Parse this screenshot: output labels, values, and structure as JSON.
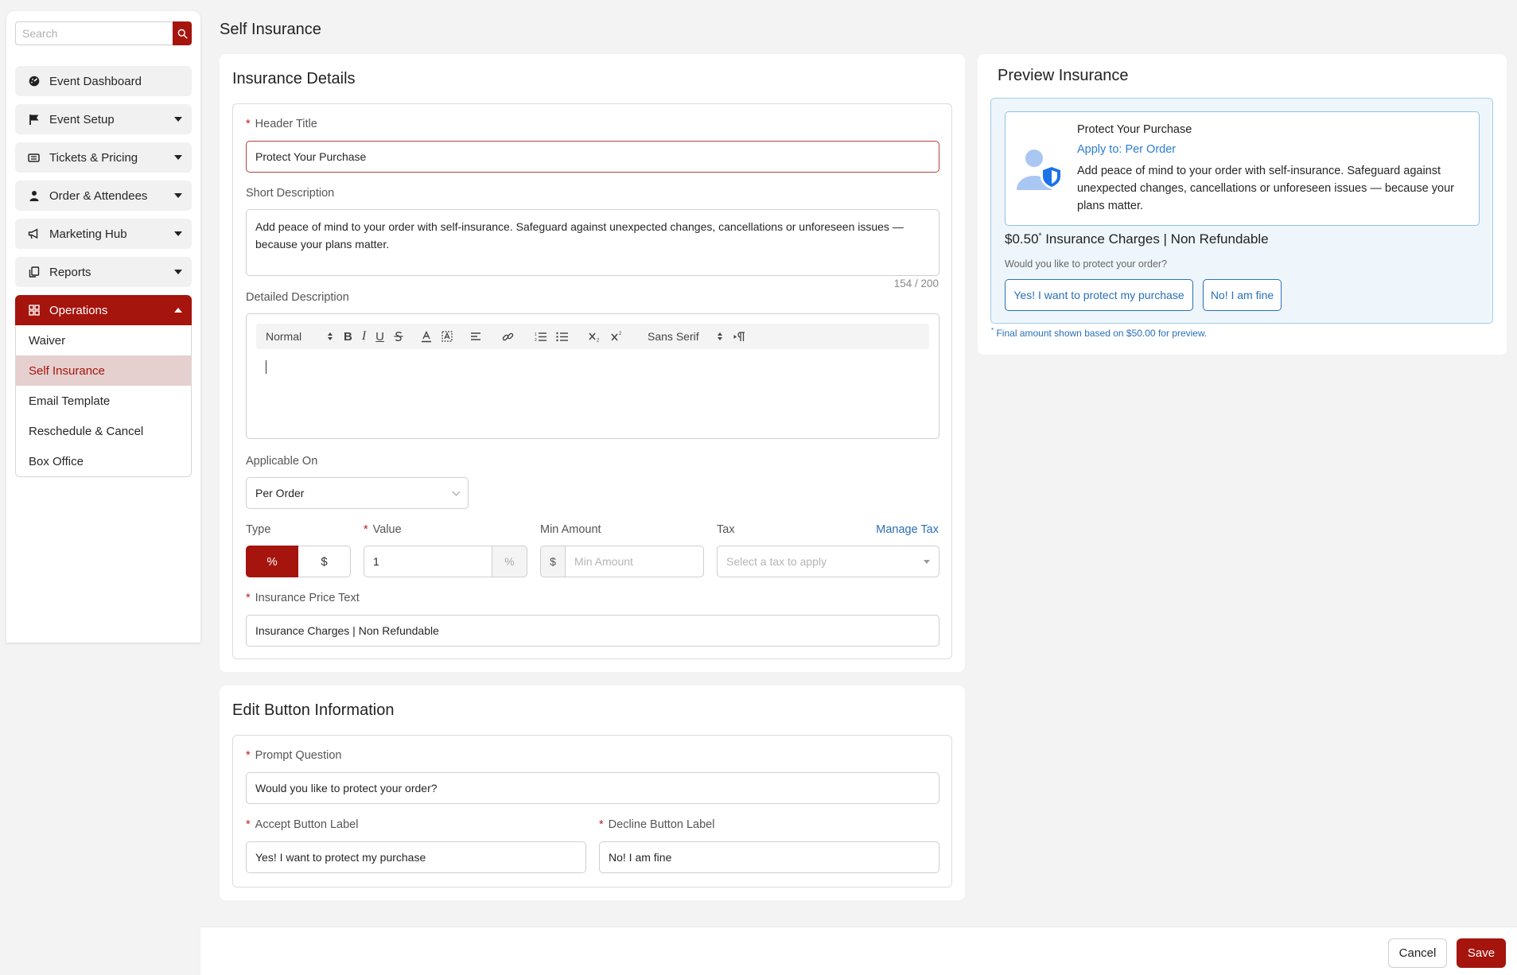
{
  "search": {
    "placeholder": "Search"
  },
  "sidebar": {
    "items": [
      {
        "label": "Event Dashboard",
        "icon": "dashboard-icon"
      },
      {
        "label": "Event Setup",
        "icon": "flag-icon"
      },
      {
        "label": "Tickets & Pricing",
        "icon": "ticket-icon"
      },
      {
        "label": "Order & Attendees",
        "icon": "person-icon"
      },
      {
        "label": "Marketing Hub",
        "icon": "megaphone-icon"
      },
      {
        "label": "Reports",
        "icon": "reports-icon"
      },
      {
        "label": "Operations",
        "icon": "grid-icon"
      }
    ],
    "sub_items": [
      "Waiver",
      "Self Insurance",
      "Email Template",
      "Reschedule & Cancel",
      "Box Office"
    ]
  },
  "page_title": "Self Insurance",
  "insurance_details": {
    "title": "Insurance Details",
    "header_title_label": "Header Title",
    "header_title_value": "Protect Your Purchase",
    "short_desc_label": "Short Description",
    "short_desc_value": "Add peace of mind to your order with self-insurance. Safeguard against unexpected changes, cancellations or unforeseen issues — because your plans matter.",
    "short_desc_counter": "154 / 200",
    "detailed_desc_label": "Detailed Description",
    "editor": {
      "format": "Normal",
      "font": "Sans Serif"
    },
    "applicable_label": "Applicable On",
    "applicable_value": "Per Order",
    "type_label": "Type",
    "type_options": [
      "%",
      "$"
    ],
    "value_label": "Value",
    "value_value": "1",
    "value_suffix": "%",
    "min_amount_label": "Min Amount",
    "min_amount_prefix": "$",
    "min_amount_placeholder": "Min Amount",
    "tax_label": "Tax",
    "manage_tax": "Manage Tax",
    "tax_placeholder": "Select a tax to apply",
    "price_text_label": "Insurance Price Text",
    "price_text_value": "Insurance Charges | Non Refundable"
  },
  "edit_buttons": {
    "title": "Edit Button Information",
    "prompt_label": "Prompt Question",
    "prompt_value": "Would you like to protect your order?",
    "accept_label": "Accept Button Label",
    "accept_value": "Yes! I want to protect my purchase",
    "decline_label": "Decline Button Label",
    "decline_value": "No! I am fine"
  },
  "preview": {
    "title": "Preview Insurance",
    "card_title": "Protect Your Purchase",
    "apply_to": "Apply to: Per Order",
    "desc": "Add peace of mind to your order with self-insurance. Safeguard against unexpected changes, cancellations or unforeseen issues — because your plans matter.",
    "price": "$0.50",
    "price_mark": "*",
    "price_text": "Insurance Charges | Non Refundable",
    "question": "Would you like to protect your order?",
    "accept": "Yes! I want to protect my purchase",
    "decline": "No! I am fine",
    "note_mark": "*",
    "note": "Final amount shown based on $50.00 for preview."
  },
  "footer": {
    "cancel": "Cancel",
    "save": "Save"
  },
  "colors": {
    "brand": "#a5140d",
    "link": "#2a6fb7",
    "preview_bg": "#eef6fc"
  }
}
